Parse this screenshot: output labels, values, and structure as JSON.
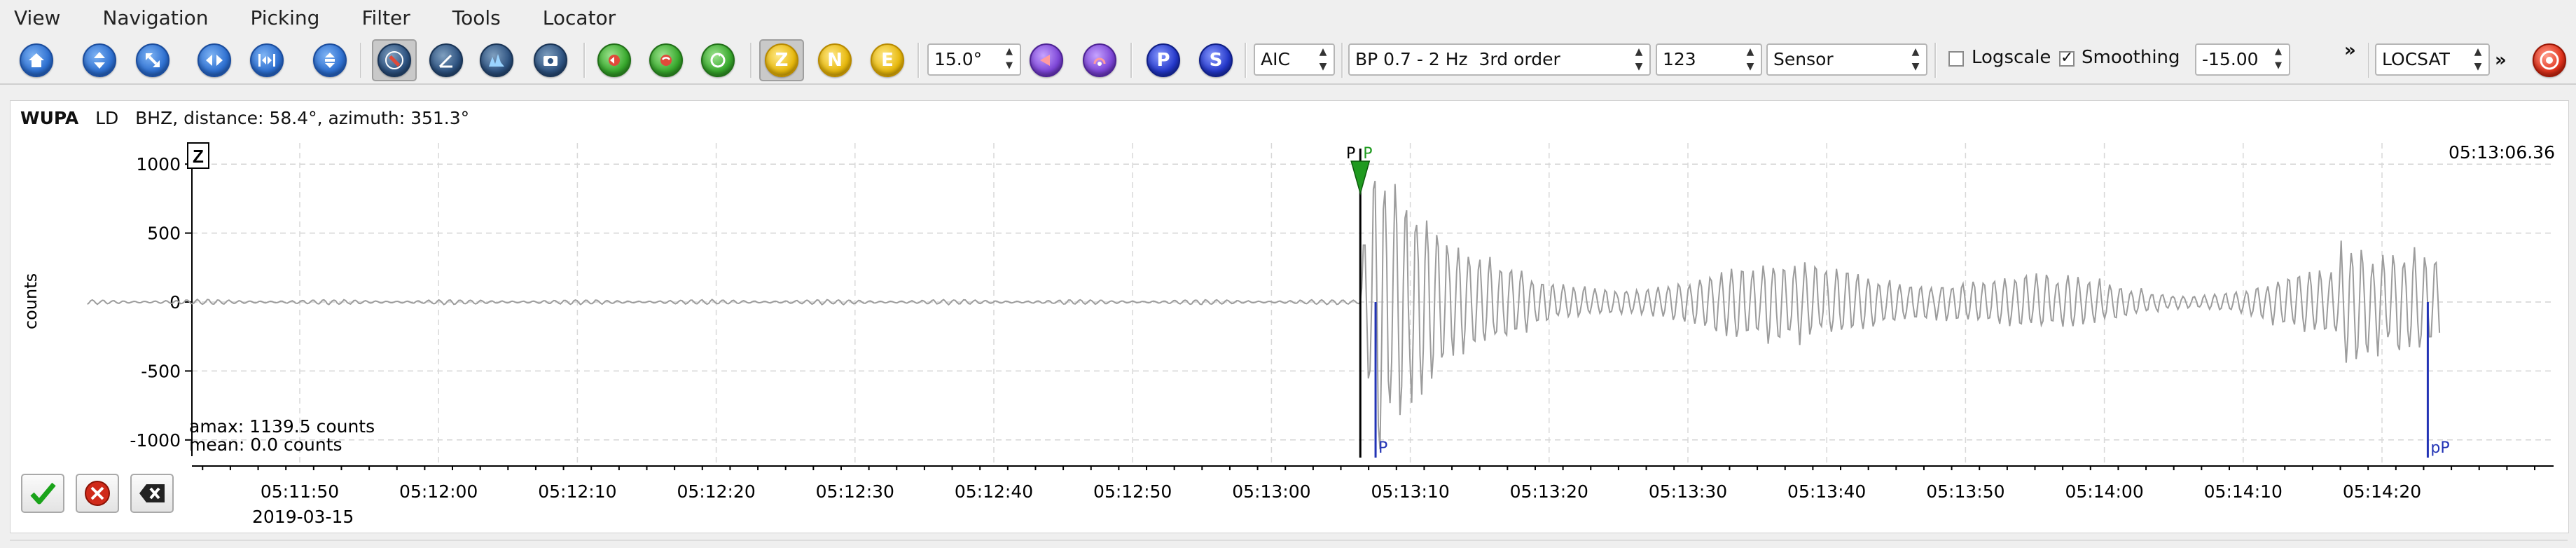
{
  "menu": [
    "View",
    "Navigation",
    "Picking",
    "Filter",
    "Tools",
    "Locator"
  ],
  "toolbar": {
    "filter_value": "15.0°",
    "method": "AIC",
    "filter_name": "BP 0.7 - 2 Hz  3rd order",
    "filter_number": "123",
    "unit": "Sensor",
    "logscale_label": "Logscale",
    "logscale_checked": false,
    "smoothing_label": "Smoothing",
    "smoothing_checked": true,
    "offset_value": "-15.00",
    "overflow_glyph": "»",
    "locator": "LOCSAT",
    "labels": {
      "Z": "Z",
      "N": "N",
      "E": "E",
      "P": "P",
      "S": "S"
    }
  },
  "trace": {
    "station": "WUPA",
    "network": "LD",
    "channel": "BHZ, distance: 58.4°, azimuth: 351.3°",
    "component": "Z",
    "time_readout": "05:13:06.36",
    "amax": "amax: 1139.5 counts",
    "mean": "mean: 0.0 counts",
    "ylabel": "counts",
    "yticks": [
      "1000",
      "500",
      "0",
      "-500",
      "-1000"
    ],
    "xticks": [
      "05:11:50",
      "05:12:00",
      "05:12:10",
      "05:12:20",
      "05:12:30",
      "05:12:40",
      "05:12:50",
      "05:13:00",
      "05:13:10",
      "05:13:20",
      "05:13:30",
      "05:13:40",
      "05:13:50",
      "05:14:00",
      "05:14:10",
      "05:14:20"
    ],
    "date": "2019-03-15",
    "picks": {
      "manual_P": "P",
      "automatic_P": "P",
      "theoretical_P": "P",
      "theoretical_pP": "pP"
    }
  },
  "colors": {
    "trace": "#9c9c9c",
    "manual_pick": "#000000",
    "auto_pick": "#1f9a1f",
    "theoretical_pick": "#2233b5",
    "accept": "#1aa31a",
    "reject": "#d02a1a"
  }
}
